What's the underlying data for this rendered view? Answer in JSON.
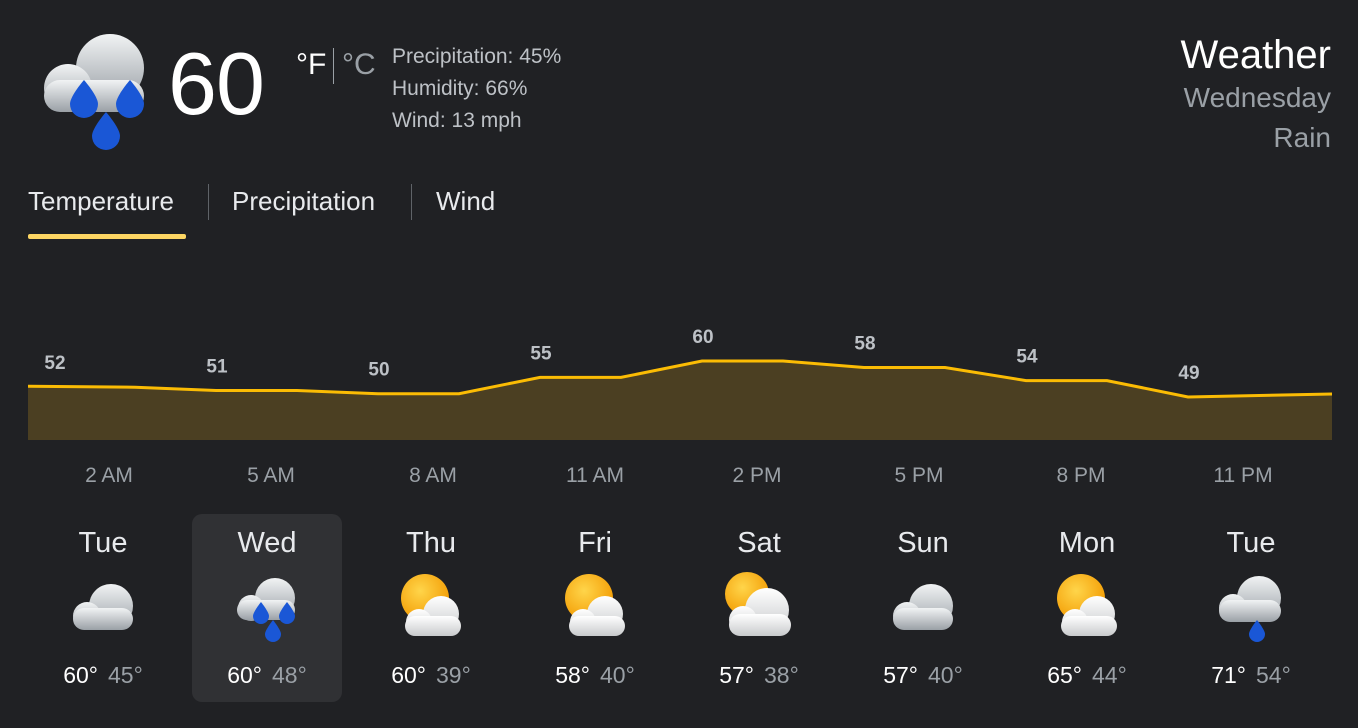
{
  "current": {
    "temperature": "60",
    "unit_f": "°F",
    "unit_c": "°C",
    "precipitation": "Precipitation: 45%",
    "humidity": "Humidity: 66%",
    "wind": "Wind: 13 mph",
    "icon": "rain-icon"
  },
  "header": {
    "title": "Weather",
    "day": "Wednesday",
    "condition": "Rain"
  },
  "tabs": [
    {
      "label": "Temperature",
      "selected": true
    },
    {
      "label": "Precipitation",
      "selected": false
    },
    {
      "label": "Wind",
      "selected": false
    }
  ],
  "chart_data": {
    "type": "area",
    "x": [
      "2 AM",
      "5 AM",
      "8 AM",
      "11 AM",
      "2 PM",
      "5 PM",
      "8 PM",
      "11 PM"
    ],
    "values": [
      52,
      51,
      50,
      55,
      60,
      58,
      54,
      49
    ],
    "labels": [
      "52",
      "51",
      "50",
      "55",
      "60",
      "58",
      "54",
      "49"
    ],
    "line_color": "#fbbc04",
    "fill_color": "#4b3f22"
  },
  "days": [
    {
      "name": "Tue",
      "high": "60°",
      "low": "45°",
      "icon": "cloudy-icon",
      "selected": false
    },
    {
      "name": "Wed",
      "high": "60°",
      "low": "48°",
      "icon": "rain-icon",
      "selected": true
    },
    {
      "name": "Thu",
      "high": "60°",
      "low": "39°",
      "icon": "partly-cloudy-icon",
      "selected": false
    },
    {
      "name": "Fri",
      "high": "58°",
      "low": "40°",
      "icon": "partly-cloudy-icon",
      "selected": false
    },
    {
      "name": "Sat",
      "high": "57°",
      "low": "38°",
      "icon": "partly-cloudy-icon",
      "selected": false
    },
    {
      "name": "Sun",
      "high": "57°",
      "low": "40°",
      "icon": "cloudy-icon",
      "selected": false
    },
    {
      "name": "Mon",
      "high": "65°",
      "low": "44°",
      "icon": "partly-cloudy-icon",
      "selected": false
    },
    {
      "name": "Tue",
      "high": "71°",
      "low": "54°",
      "icon": "light-rain-icon",
      "selected": false
    }
  ]
}
